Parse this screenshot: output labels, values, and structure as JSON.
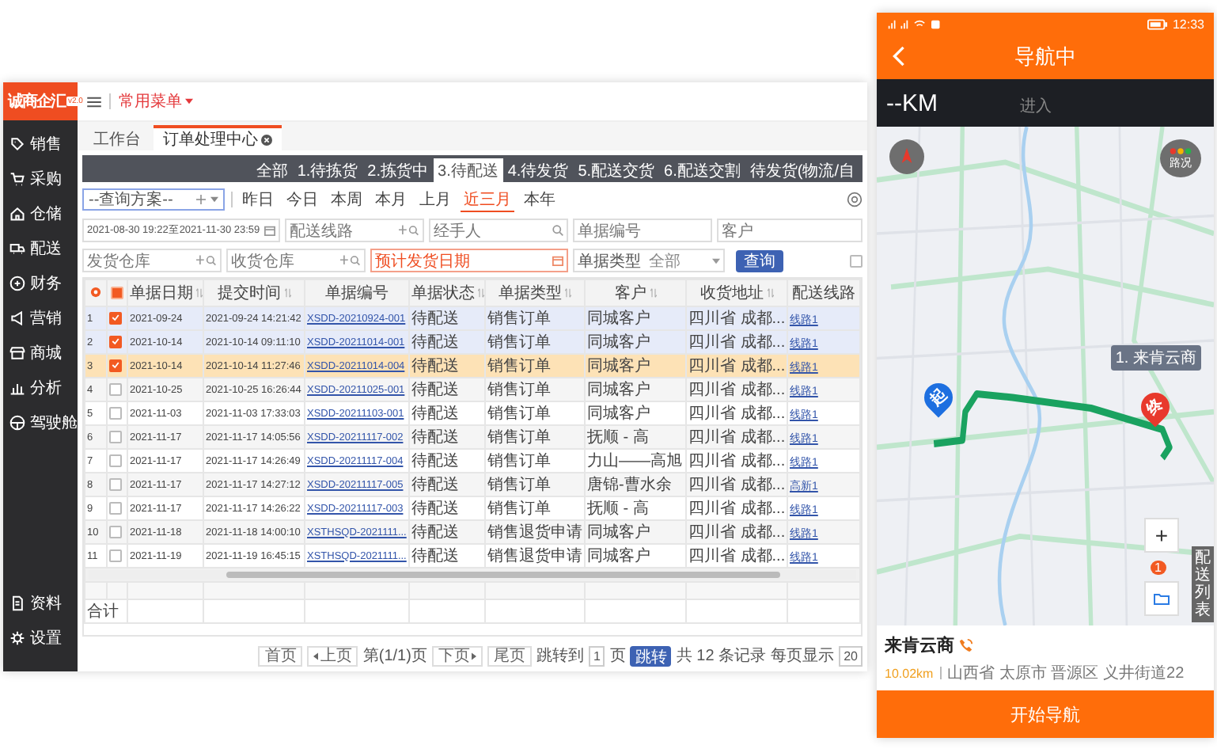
{
  "app": {
    "logo": "诚商企汇",
    "version": "v2.0",
    "menu_label": "常用菜单",
    "sidebar": [
      {
        "label": "销售"
      },
      {
        "label": "采购"
      },
      {
        "label": "仓储"
      },
      {
        "label": "配送"
      },
      {
        "label": "财务"
      },
      {
        "label": "营销"
      },
      {
        "label": "商城"
      },
      {
        "label": "分析"
      },
      {
        "label": "驾驶舱"
      }
    ],
    "sidebar_bottom": [
      {
        "label": "资料"
      },
      {
        "label": "设置"
      }
    ],
    "tabs": [
      {
        "label": "工作台",
        "selected": false,
        "closable": false
      },
      {
        "label": "订单处理中心",
        "selected": true,
        "closable": true
      }
    ],
    "status_tabs": [
      {
        "label": "全部",
        "selected": false
      },
      {
        "label": "1.待拣货",
        "selected": false
      },
      {
        "label": "2.拣货中",
        "selected": false
      },
      {
        "label": "3.待配送",
        "selected": true
      },
      {
        "label": "4.待发货",
        "selected": false
      },
      {
        "label": "5.配送交货",
        "selected": false
      },
      {
        "label": "6.配送交割",
        "selected": false
      },
      {
        "label": "待发货(物流/自",
        "selected": false
      }
    ],
    "scheme": "--查询方案--",
    "quick_dates": [
      {
        "label": "昨日",
        "selected": false
      },
      {
        "label": "今日",
        "selected": false
      },
      {
        "label": "本周",
        "selected": false
      },
      {
        "label": "本月",
        "selected": false
      },
      {
        "label": "上月",
        "selected": false
      },
      {
        "label": "近三月",
        "selected": true
      },
      {
        "label": "本年",
        "selected": false
      }
    ],
    "filter_rows": [
      [
        {
          "kind": "date",
          "value": "2021-08-30 19:22至2021-11-30 23:59",
          "highlighted": false
        },
        {
          "kind": "lookup",
          "placeholder": "配送线路",
          "highlighted": false
        },
        {
          "kind": "search",
          "placeholder": "经手人",
          "highlighted": false
        },
        {
          "kind": "text",
          "placeholder": "单据编号",
          "highlighted": false
        },
        {
          "kind": "text",
          "placeholder": "客户",
          "highlighted": false
        }
      ],
      [
        {
          "kind": "lookup",
          "placeholder": "发货仓库",
          "highlighted": false
        },
        {
          "kind": "lookup",
          "placeholder": "收货仓库",
          "highlighted": false
        },
        {
          "kind": "date",
          "placeholder": "预计发货日期",
          "highlighted": true
        },
        {
          "kind": "select",
          "label": "单据类型",
          "value": "全部",
          "highlighted": false
        },
        {
          "kind": "button",
          "label": "查询"
        },
        {
          "kind": "checkbox",
          "checked": false
        }
      ]
    ],
    "table": {
      "indeterminate": true,
      "columns": [
        {
          "label": "单据日期",
          "sortable": true
        },
        {
          "label": "提交时间",
          "sortable": true
        },
        {
          "label": "单据编号",
          "sortable": false
        },
        {
          "label": "单据状态",
          "sortable": true
        },
        {
          "label": "单据类型",
          "sortable": true
        },
        {
          "label": "客户",
          "sortable": true
        },
        {
          "label": "收货地址",
          "sortable": true
        },
        {
          "label": "配送线路",
          "sortable": false
        }
      ],
      "rows": [
        {
          "no": "1",
          "checked": true,
          "current": false,
          "date": "2021-09-24",
          "time": "2021-09-24 14:21:42",
          "doc_no": "XSDD-20210924-001",
          "status": "待配送",
          "type": "销售订单",
          "customer": "同城客户",
          "address": "四川省 成都...",
          "route": "线路1"
        },
        {
          "no": "2",
          "checked": true,
          "current": false,
          "date": "2021-10-14",
          "time": "2021-10-14 09:11:10",
          "doc_no": "XSDD-20211014-001",
          "status": "待配送",
          "type": "销售订单",
          "customer": "同城客户",
          "address": "四川省 成都...",
          "route": "线路1"
        },
        {
          "no": "3",
          "checked": true,
          "current": true,
          "date": "2021-10-14",
          "time": "2021-10-14 11:27:46",
          "doc_no": "XSDD-20211014-004",
          "status": "待配送",
          "type": "销售订单",
          "customer": "同城客户",
          "address": "四川省 成都...",
          "route": "线路1"
        },
        {
          "no": "4",
          "checked": false,
          "current": false,
          "date": "2021-10-25",
          "time": "2021-10-25 16:26:44",
          "doc_no": "XSDD-20211025-001",
          "status": "待配送",
          "type": "销售订单",
          "customer": "同城客户",
          "address": "四川省 成都...",
          "route": "线路1"
        },
        {
          "no": "5",
          "checked": false,
          "current": false,
          "date": "2021-11-03",
          "time": "2021-11-03 17:33:03",
          "doc_no": "XSDD-20211103-001",
          "status": "待配送",
          "type": "销售订单",
          "customer": "同城客户",
          "address": "四川省 成都...",
          "route": "线路1"
        },
        {
          "no": "6",
          "checked": false,
          "current": false,
          "date": "2021-11-17",
          "time": "2021-11-17 14:05:56",
          "doc_no": "XSDD-20211117-002",
          "status": "待配送",
          "type": "销售订单",
          "customer": "抚顺 - 高",
          "address": "四川省 成都...",
          "route": "线路1"
        },
        {
          "no": "7",
          "checked": false,
          "current": false,
          "date": "2021-11-17",
          "time": "2021-11-17 14:26:49",
          "doc_no": "XSDD-20211117-004",
          "status": "待配送",
          "type": "销售订单",
          "customer": "力山——高旭",
          "address": "四川省 成都...",
          "route": "线路1"
        },
        {
          "no": "8",
          "checked": false,
          "current": false,
          "date": "2021-11-17",
          "time": "2021-11-17 14:27:12",
          "doc_no": "XSDD-20211117-005",
          "status": "待配送",
          "type": "销售订单",
          "customer": "唐锦-曹水余",
          "address": "四川省 成都...",
          "route": "高新1"
        },
        {
          "no": "9",
          "checked": false,
          "current": false,
          "date": "2021-11-17",
          "time": "2021-11-17 14:26:22",
          "doc_no": "XSDD-20211117-003",
          "status": "待配送",
          "type": "销售订单",
          "customer": "抚顺 - 高",
          "address": "四川省 成都...",
          "route": "线路1"
        },
        {
          "no": "10",
          "checked": false,
          "current": false,
          "date": "2021-11-18",
          "time": "2021-11-18 14:00:10",
          "doc_no": "XSTHSQD-2021111...",
          "status": "待配送",
          "type": "销售退货申请",
          "customer": "同城客户",
          "address": "四川省 成都...",
          "route": "线路1"
        },
        {
          "no": "11",
          "checked": false,
          "current": false,
          "date": "2021-11-19",
          "time": "2021-11-19 16:45:15",
          "doc_no": "XSTHSQD-2021111...",
          "status": "待配送",
          "type": "销售退货申请",
          "customer": "同城客户",
          "address": "四川省 成都...",
          "route": "线路1"
        }
      ],
      "footer": "合计"
    },
    "pager": {
      "first": "首页",
      "prev": "上页",
      "page": "第(1/1)页",
      "next": "下页",
      "last": "尾页",
      "jump_label": "跳转到",
      "jump_value": "1",
      "jump_unit": "页",
      "jump_button": "跳转",
      "total": "共 12 条记录",
      "per_page_label": "每页显示",
      "per_page": "20"
    }
  },
  "phone": {
    "time": "12:33",
    "title": "导航中",
    "distance": "--KM",
    "hint": "进入",
    "traffic": "路况",
    "route_label": "1. 来肯云商",
    "start_marker": "起",
    "end_marker": "终",
    "zoom_in": "+",
    "list_badge": "1",
    "list_button": "配送列表",
    "destination": {
      "name": "来肯云商",
      "distance": "10.02km",
      "address": "山西省 太原市 晋源区 义井街道22"
    },
    "start_button": "开始导航"
  }
}
